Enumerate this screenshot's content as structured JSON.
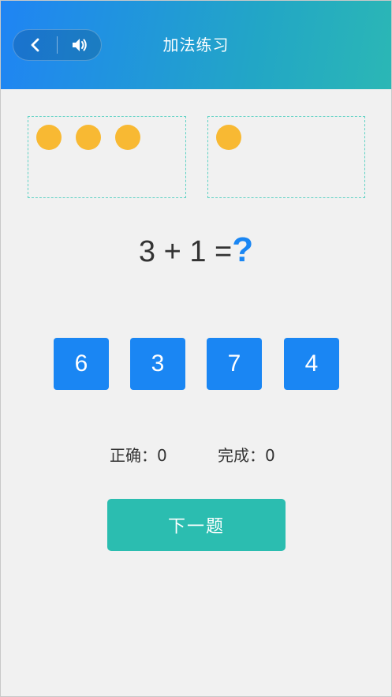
{
  "header": {
    "title": "加法练习",
    "back_icon": "chevron-left-icon",
    "sound_icon": "speaker-icon"
  },
  "counting": {
    "left_count": 3,
    "right_count": 1,
    "dot_color": "#f8b933"
  },
  "question": {
    "a": "3",
    "op": "+",
    "b": "1",
    "eq": "=",
    "unknown": "?"
  },
  "options": [
    "6",
    "3",
    "7",
    "4"
  ],
  "stats": {
    "correct_label": "正确：",
    "correct_value": "0",
    "done_label": "完成：",
    "done_value": "0"
  },
  "actions": {
    "next_label": "下一题"
  },
  "colors": {
    "header_start": "#1f84f4",
    "header_end": "#2bb7b5",
    "option_bg": "#1a86f3",
    "next_bg": "#2bbdb0",
    "question_mark": "#1a86f3"
  }
}
